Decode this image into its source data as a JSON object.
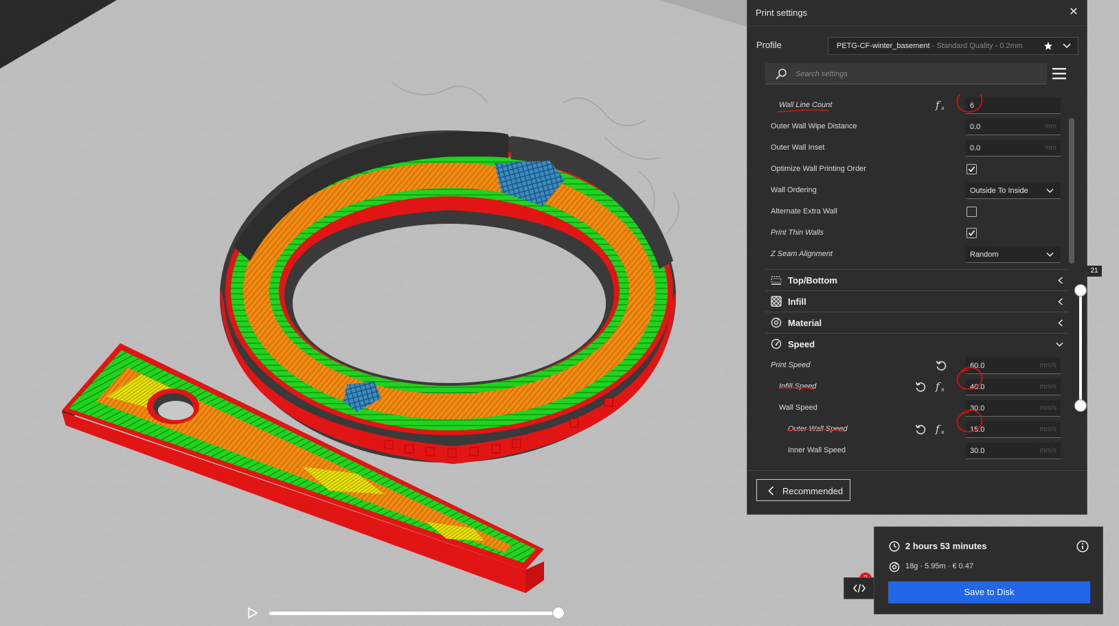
{
  "panel": {
    "title": "Print settings",
    "close_symbol": "✕",
    "profile_label": "Profile",
    "profile_name": "PETG-CF-winter_basement",
    "profile_quality": " - Standard Quality - 0.2mm",
    "search_placeholder": "Search settings"
  },
  "settings": {
    "wall_line_count": {
      "label": "Wall Line Count",
      "value": "6"
    },
    "outer_wall_wipe": {
      "label": "Outer Wall Wipe Distance",
      "value": "0.0",
      "unit": "mm"
    },
    "outer_wall_inset": {
      "label": "Outer Wall Inset",
      "value": "0.0",
      "unit": "mm"
    },
    "optimize_wall_order": {
      "label": "Optimize Wall Printing Order",
      "checked": true
    },
    "wall_ordering": {
      "label": "Wall Ordering",
      "value": "Outside To Inside"
    },
    "alternate_extra_wall": {
      "label": "Alternate Extra Wall",
      "checked": false
    },
    "print_thin_walls": {
      "label": "Print Thin Walls",
      "checked": true
    },
    "z_seam_alignment": {
      "label": "Z Seam Alignment",
      "value": "Random"
    },
    "print_speed": {
      "label": "Print Speed",
      "value": "60.0",
      "unit": "mm/s"
    },
    "infill_speed": {
      "label": "Infill Speed",
      "value": "40.0",
      "unit": "mm/s"
    },
    "wall_speed": {
      "label": "Wall Speed",
      "value": "30.0",
      "unit": "mm/s"
    },
    "outer_wall_speed": {
      "label": "Outer Wall Speed",
      "value": "15.0",
      "unit": "mm/s"
    },
    "inner_wall_speed": {
      "label": "Inner Wall Speed",
      "value": "30.0",
      "unit": "mm/s"
    }
  },
  "categories": {
    "top_bottom": "Top/Bottom",
    "infill": "Infill",
    "material": "Material",
    "speed": "Speed"
  },
  "footer": {
    "recommended_label": "Recommended"
  },
  "layer_slider": {
    "current_layer": "21"
  },
  "print_info": {
    "time": "2 hours 53 minutes",
    "material_usage": "18g · 5.95m · € 0.47",
    "save_label": "Save to Disk"
  },
  "notifications": {
    "count": "2"
  },
  "colors": {
    "panel_bg": "#2d2d2d",
    "accent_blue": "#2167e8",
    "annotation_red": "#e01010",
    "wall_red": "#e21515",
    "wall_green": "#1fd31f",
    "infill_orange": "#f08a10",
    "skin_yellow": "#e8e000",
    "support_blue": "#3a8fb8"
  }
}
